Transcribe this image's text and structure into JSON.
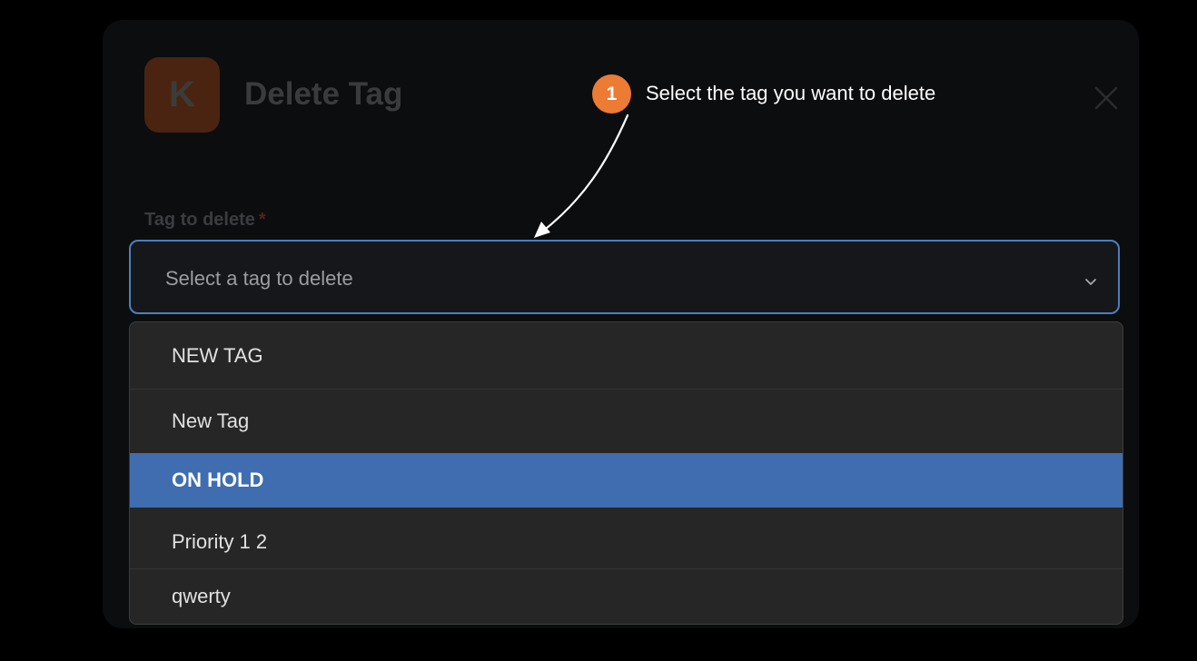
{
  "modal": {
    "logo_letter": "K",
    "title": "Delete Tag"
  },
  "form": {
    "label": "Tag to delete",
    "required_mark": "*",
    "select_placeholder": "Select a tag to delete"
  },
  "dropdown": {
    "options": [
      {
        "label": "NEW TAG",
        "selected": false
      },
      {
        "label": "New Tag",
        "selected": false
      },
      {
        "label": "ON HOLD",
        "selected": true
      },
      {
        "label": "Priority 1 2",
        "selected": false
      },
      {
        "label": "qwerty",
        "selected": false
      }
    ]
  },
  "callout": {
    "step": "1",
    "text": "Select the tag you want to delete"
  },
  "colors": {
    "accent_orange": "#ec7b34",
    "highlight_blue": "#3f6db0",
    "focus_border": "#4d7fbf",
    "logo_bg": "#4a2410"
  },
  "icons": {
    "close": "close-icon",
    "chevron": "chevron-down-icon",
    "arrow": "arrow-icon"
  }
}
